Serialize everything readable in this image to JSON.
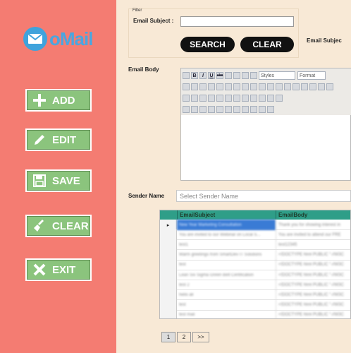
{
  "brand": {
    "name": "oMail",
    "color": "#4aa6e0"
  },
  "sidebar": {
    "buttons": [
      {
        "label": "ADD",
        "icon": "plus-icon"
      },
      {
        "label": "EDIT",
        "icon": "pencil-icon"
      },
      {
        "label": "SAVE",
        "icon": "save-disk-icon"
      },
      {
        "label": "CLEAR",
        "icon": "broom-icon"
      },
      {
        "label": "EXIT",
        "icon": "close-x-icon"
      }
    ]
  },
  "filter": {
    "legend": "Filter",
    "subject_label": "Email Subject :",
    "subject_value": "",
    "search_label": "SEARCH",
    "clear_label": "CLEAR",
    "right_label": "Email Subjec"
  },
  "editor": {
    "label": "Email Body",
    "styles_placeholder": "Styles",
    "format_placeholder": "Format",
    "bold": "B",
    "italic": "I",
    "underline": "U",
    "strike": "abc"
  },
  "sender": {
    "label": "Sender Name",
    "placeholder": "Select Sender Name"
  },
  "grid": {
    "columns": [
      "EmailSubject",
      "EmailBody"
    ],
    "selected_marker": "▸",
    "rows": [
      [
        "New Year Marketing Consultation",
        "Thank you for showing interest in"
      ],
      [
        "You are invited to our Webinar on Local S...",
        "You are invited to attend our FRE"
      ],
      [
        "test1",
        "test12345"
      ],
      [
        "Warm greetings from SmartDev IT Solutions",
        "<!DOCTYPE html PUBLIC \"-//W3C"
      ],
      [
        "test",
        "<!DOCTYPE html PUBLIC \"-//W3C"
      ],
      [
        "Lean Six Sigma Green Belt Certification",
        "<!DOCTYPE html PUBLIC \"-//W3C"
      ],
      [
        "test 2",
        "<!DOCTYPE html PUBLIC \"-//W3C"
      ],
      [
        "hello all",
        "<!DOCTYPE html PUBLIC \"-//W3C"
      ],
      [
        "test",
        "<!DOCTYPE html PUBLIC \"-//W3C"
      ],
      [
        "test mail",
        "<!DOCTYPE html PUBLIC \"-//W3C"
      ]
    ]
  },
  "pager": {
    "pages": [
      "1",
      "2",
      ">>"
    ],
    "current": "1"
  }
}
